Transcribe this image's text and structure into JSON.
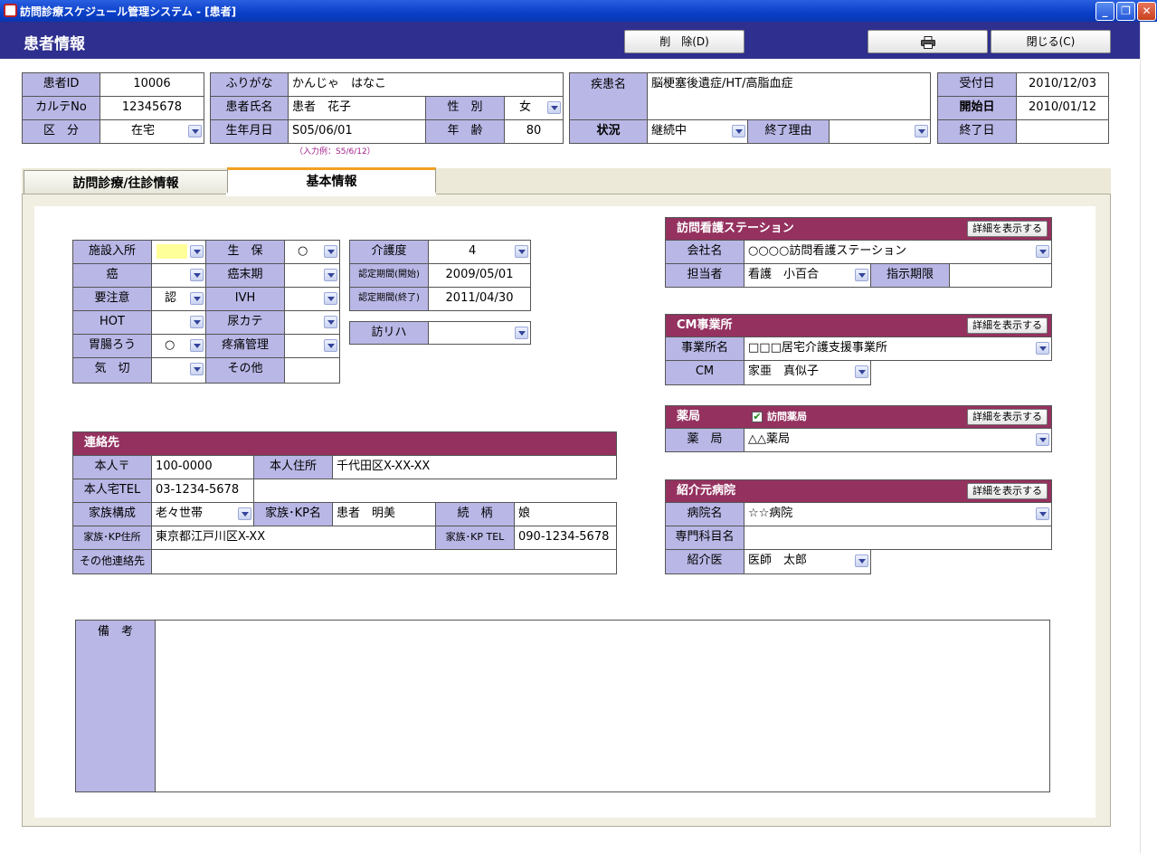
{
  "window": {
    "title": "訪問診療スケジュール管理システム - [患者]"
  },
  "header": {
    "title": "患者情報",
    "delete_label": "削　除(D)",
    "close_label": "閉じる(C)"
  },
  "patient": {
    "id_label": "患者ID",
    "id": "10006",
    "karte_label": "カルテNo",
    "karte": "12345678",
    "kubun_label": "区　分",
    "kubun": "在宅",
    "furigana_label": "ふりがな",
    "furigana": "かんじゃ　はなこ",
    "name_label": "患者氏名",
    "name": "患者　花子",
    "birth_label": "生年月日",
    "birth": "S05/06/01",
    "birth_hint": "（入力例：S5/6/12）",
    "sex_label": "性　別",
    "sex": "女",
    "age_label": "年　齢",
    "age": "80",
    "disease_label": "疾患名",
    "disease": "脳梗塞後遺症/HT/高脂血症",
    "status_label": "状況",
    "status": "継続中",
    "end_reason_label": "終了理由",
    "end_reason": "",
    "uketsuke_label": "受付日",
    "uketsuke": "2010/12/03",
    "start_label": "開始日",
    "start": "2010/01/12",
    "end_label": "終了日",
    "end": ""
  },
  "tabs": {
    "visit": "訪問診療/往診情報",
    "basic": "基本情報"
  },
  "basic": {
    "shisetsu_label": "施設入所",
    "shisetsu": "",
    "seiho_label": "生　保",
    "seiho": "○",
    "gan_label": "癌",
    "gan": "",
    "ganmakki_label": "癌末期",
    "ganmakki": "",
    "youchui_label": "要注意",
    "youchui": "認",
    "ivh_label": "IVH",
    "ivh": "",
    "hot_label": "HOT",
    "hot": "",
    "nyokate_label": "尿カテ",
    "nyokate": "",
    "irou_label": "胃腸ろう",
    "irou": "○",
    "toutsu_label": "疼痛管理",
    "toutsu": "",
    "kisetsu_label": "気　切",
    "kisetsu": "",
    "sonota_label": "その他",
    "sonota": "",
    "kaigo_label": "介護度",
    "kaigo": "4",
    "nintei_start_label": "認定期間(開始)",
    "nintei_start": "2009/05/01",
    "nintei_end_label": "認定期間(終了)",
    "nintei_end": "2011/04/30",
    "houriha_label": "訪リハ",
    "houriha": ""
  },
  "contact": {
    "title": "連絡先",
    "zip_label": "本人〒",
    "zip": "100-0000",
    "addr_label": "本人住所",
    "addr": "千代田区X-XX-XX",
    "tel_label": "本人宅TEL",
    "tel": "03-1234-5678",
    "family_label": "家族構成",
    "family": "老々世帯",
    "kp_name_label": "家族･KP名",
    "kp_name": "患者　明美",
    "relation_label": "続　柄",
    "relation": "娘",
    "kp_addr_label": "家族･KP住所",
    "kp_addr": "東京都江戸川区X-XX",
    "kp_tel_label": "家族･KP TEL",
    "kp_tel": "090-1234-5678",
    "other_label": "その他連絡先",
    "other": ""
  },
  "remarks": {
    "label": "備　考",
    "text": ""
  },
  "nursing": {
    "title": "訪問看護ステーション",
    "detail": "詳細を表示する",
    "company_label": "会社名",
    "company": "○○○○訪問看護ステーション",
    "staff_label": "担当者",
    "staff": "看護　小百合",
    "period_label": "指示期限",
    "period": ""
  },
  "cm": {
    "title": "CM事業所",
    "detail": "詳細を表示する",
    "office_label": "事業所名",
    "office": "□□□居宅介護支援事業所",
    "cm_label": "CM",
    "cm": "家亜　真似子"
  },
  "pharmacy": {
    "title": "薬局",
    "check_label": "訪問薬局",
    "checked": true,
    "detail": "詳細を表示する",
    "name_label": "薬　局",
    "name": "△△薬局"
  },
  "hospital": {
    "title": "紹介元病院",
    "detail": "詳細を表示する",
    "name_label": "病院名",
    "name": "☆☆病院",
    "dept_label": "専門科目名",
    "dept": "",
    "doctor_label": "紹介医",
    "doctor": "医師　太郎"
  },
  "colors": {
    "header": "#2e2f8e",
    "label_bg": "#b9b7e6",
    "section_head": "#94315f"
  },
  "icons": {
    "print": "printer-icon"
  }
}
